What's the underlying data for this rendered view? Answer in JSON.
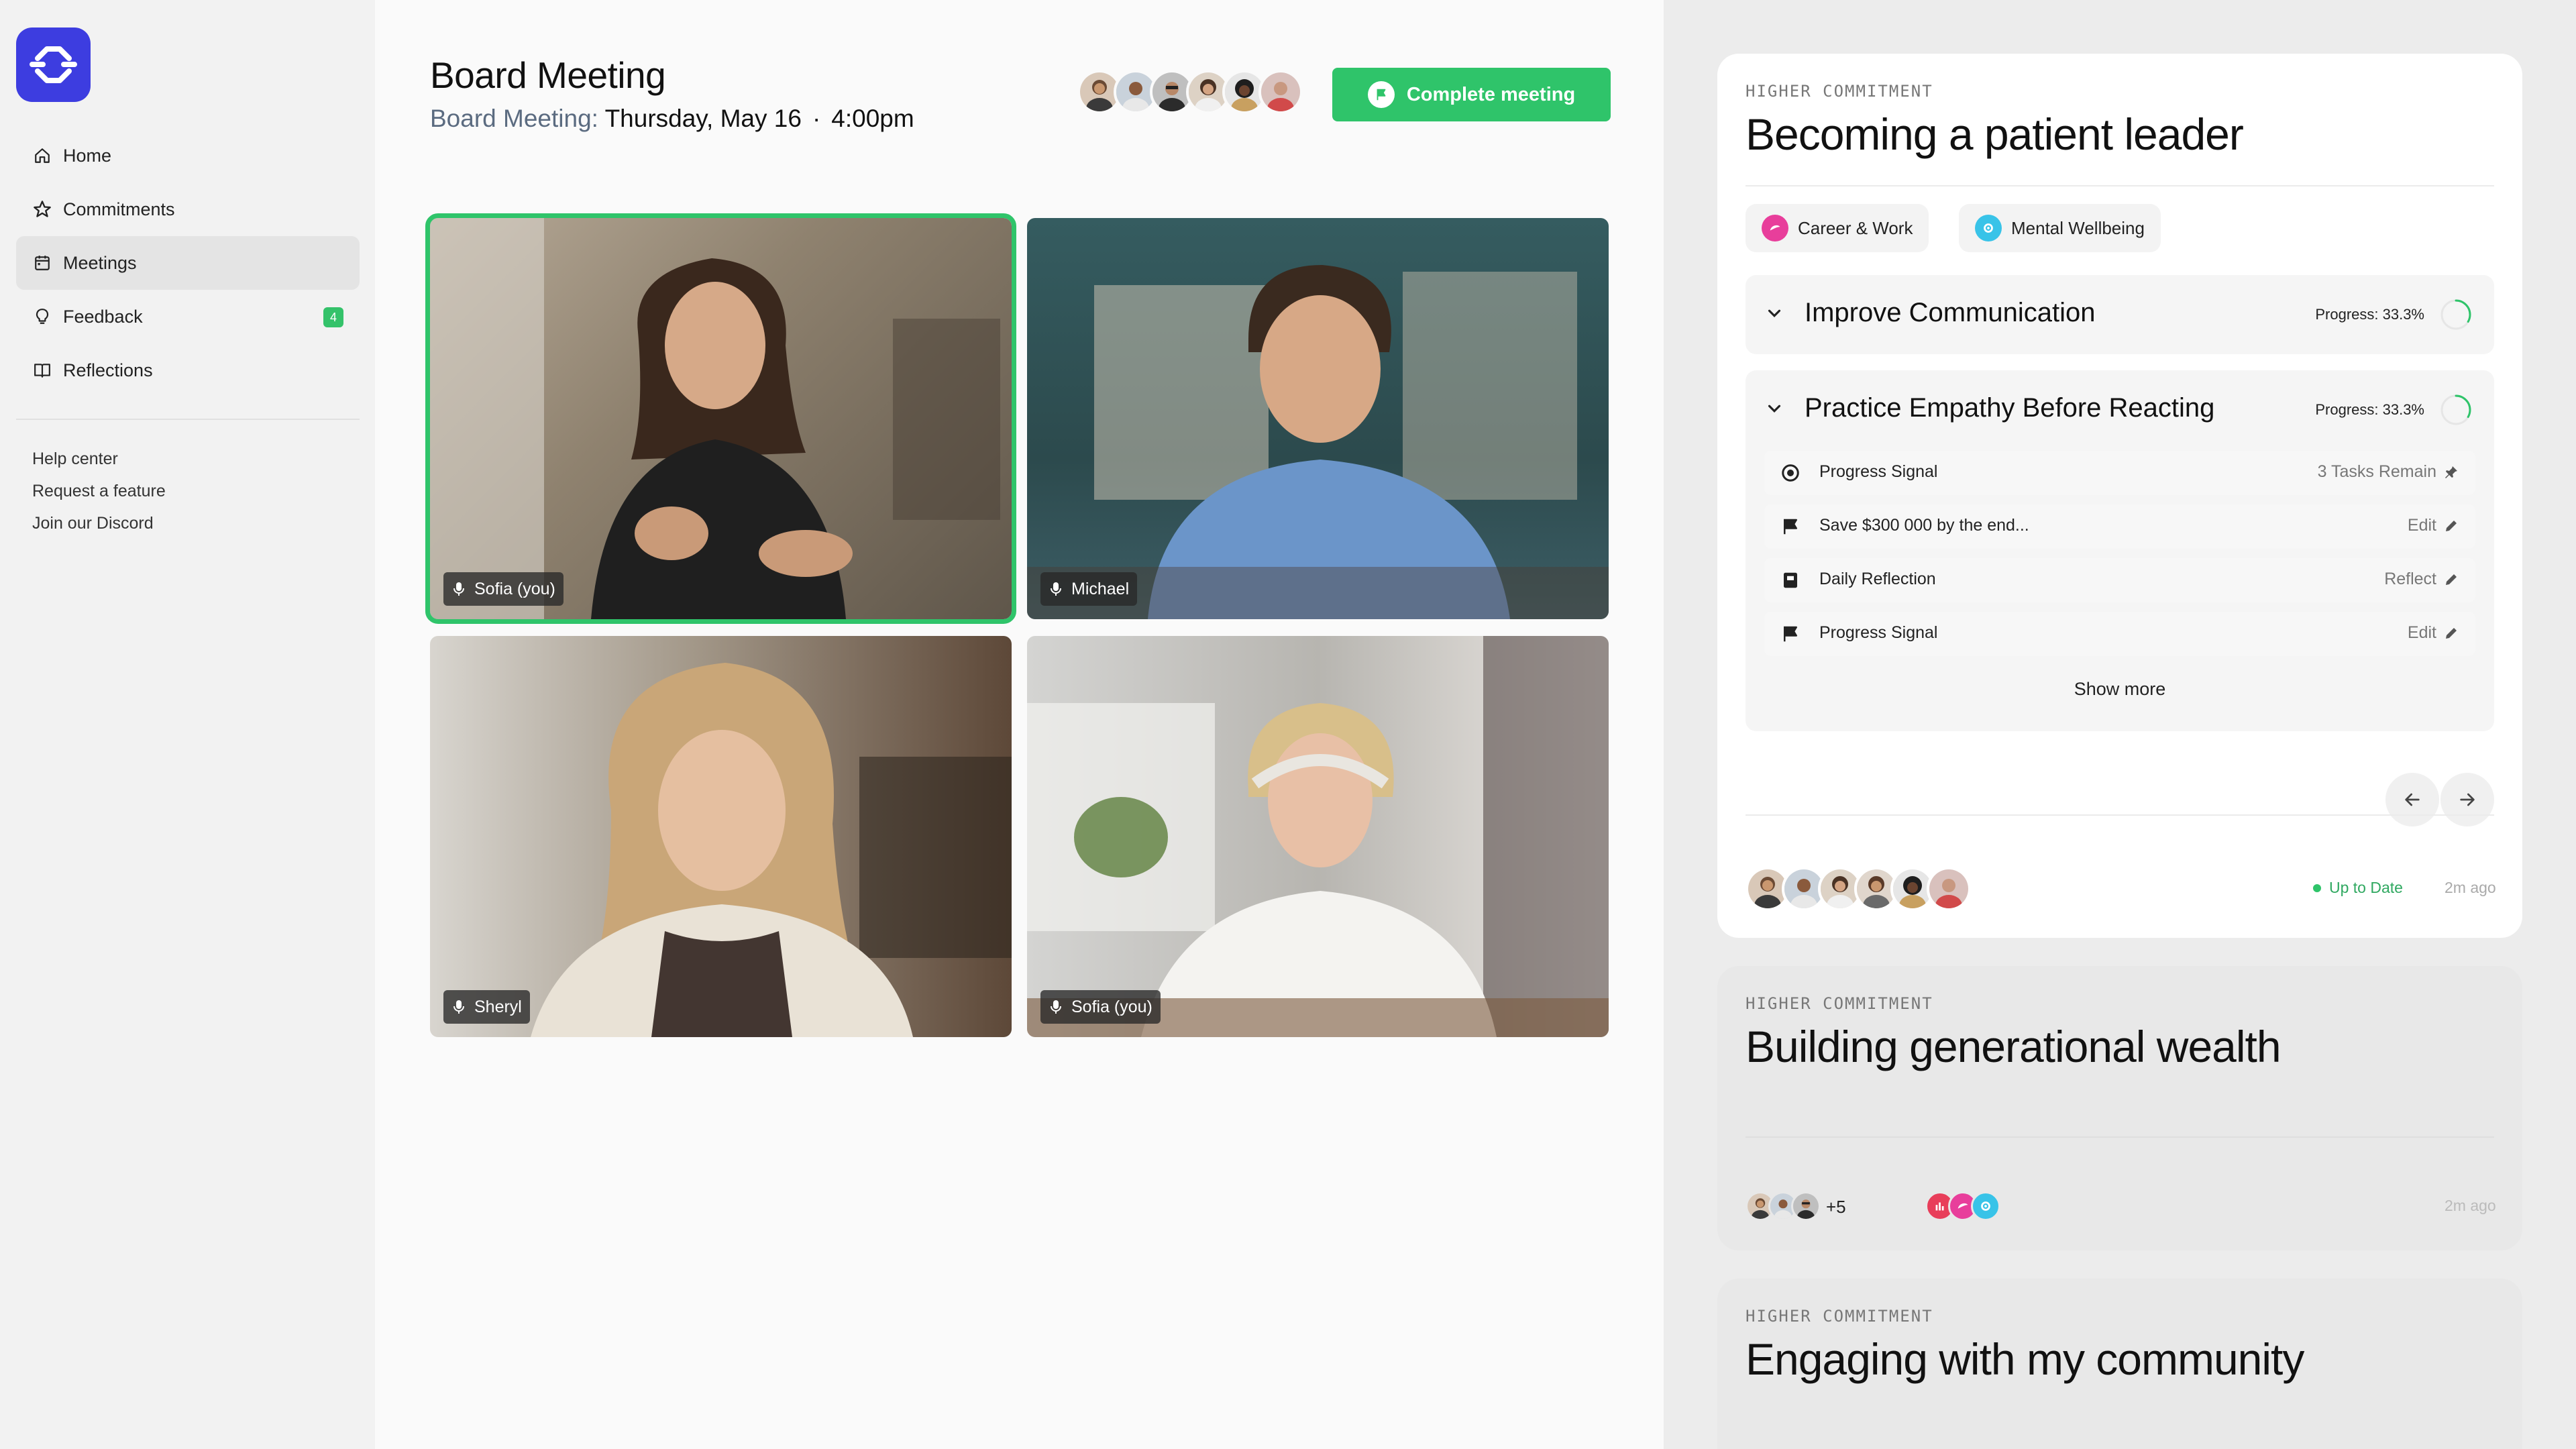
{
  "nav": {
    "items": [
      {
        "label": "Home",
        "icon": "home-icon"
      },
      {
        "label": "Commitments",
        "icon": "star-icon"
      },
      {
        "label": "Meetings",
        "icon": "calendar-icon"
      },
      {
        "label": "Feedback",
        "icon": "lightbulb-icon",
        "badge": "4"
      },
      {
        "label": "Reflections",
        "icon": "book-icon"
      }
    ],
    "links": [
      "Help center",
      "Request a feature",
      "Join our Discord"
    ]
  },
  "meeting": {
    "title": "Board Meeting",
    "subtitle_label": "Board Meeting:",
    "date": "Thursday, May 16",
    "separator": "·",
    "time": "4:00pm",
    "complete_button": "Complete meeting"
  },
  "participants": [
    {
      "name": "Sofia (you)",
      "active": true
    },
    {
      "name": "Michael",
      "active": false
    },
    {
      "name": "Sheryl",
      "active": false
    },
    {
      "name": "Sofia (you)",
      "active": false
    }
  ],
  "colors": {
    "accent": "#2fc46a",
    "brand": "#3d3de0",
    "career": "#e83e9b",
    "wellbeing": "#38c3e8",
    "finance": "#e83e5a"
  },
  "commitment_1": {
    "eyebrow": "HIGHER COMMITMENT",
    "title": "Becoming a patient leader",
    "tags": [
      "Career & Work",
      "Mental Wellbeing"
    ],
    "goals": [
      {
        "title": "Improve Communication",
        "progress": "Progress: 33.3%",
        "progress_value": 0.333
      },
      {
        "title": "Practice Empathy Before Reacting",
        "progress": "Progress: 33.3%",
        "progress_value": 0.333
      }
    ],
    "tasks": [
      {
        "icon": "target-icon",
        "label": "Progress Signal",
        "action": "3 Tasks Remain",
        "action_icon": "pin-icon"
      },
      {
        "icon": "flag-icon",
        "label": "Save $300 000 by the end...",
        "action": "Edit",
        "action_icon": "pencil-icon"
      },
      {
        "icon": "journal-icon",
        "label": "Daily Reflection",
        "action": "Reflect",
        "action_icon": "pencil-icon"
      },
      {
        "icon": "flag-icon",
        "label": "Progress Signal",
        "action": "Edit",
        "action_icon": "pencil-icon"
      }
    ],
    "show_more": "Show more",
    "status": "Up to Date",
    "ago": "2m ago"
  },
  "commitment_2": {
    "eyebrow": "HIGHER COMMITMENT",
    "title": "Building generational wealth",
    "more_count": "+5",
    "ago": "2m ago"
  },
  "commitment_3": {
    "eyebrow": "HIGHER COMMITMENT",
    "title": "Engaging with my community"
  }
}
